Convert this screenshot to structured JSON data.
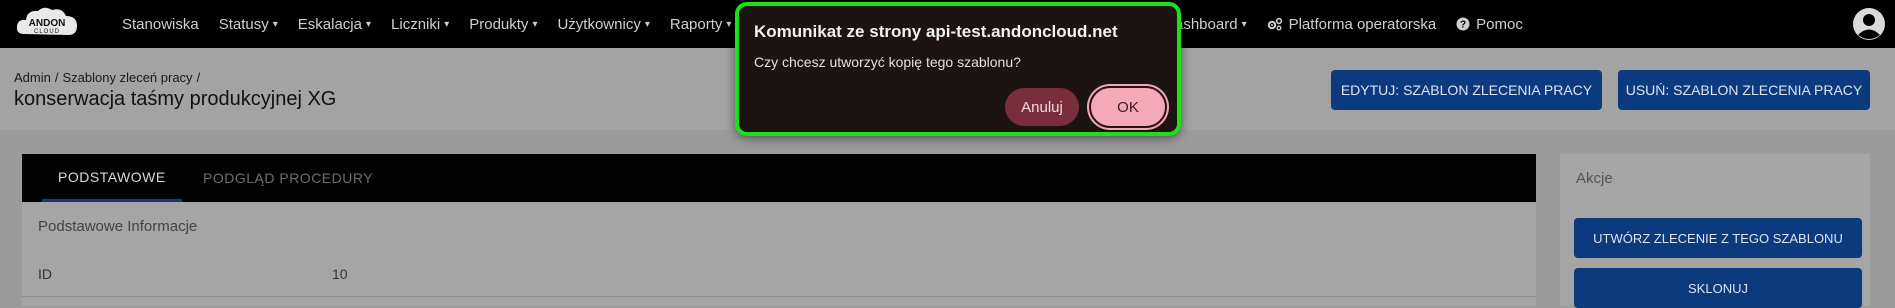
{
  "navbar": {
    "logo_text_top": "ANDON",
    "logo_text_bottom": "CLOUD",
    "items": [
      {
        "label": "Stanowiska",
        "caret": ""
      },
      {
        "label": "Statusy",
        "caret": "▾"
      },
      {
        "label": "Eskalacja",
        "caret": "▾"
      },
      {
        "label": "Liczniki",
        "caret": "▾"
      },
      {
        "label": "Produkty",
        "caret": "▾"
      },
      {
        "label": "Użytkownicy",
        "caret": "▾"
      },
      {
        "label": "Raporty",
        "caret": "▾"
      }
    ],
    "right_items": [
      {
        "label": "ashboard",
        "caret": "▾",
        "icon": ""
      },
      {
        "label": "Platforma operatorska",
        "caret": "",
        "icon": "gears-icon"
      },
      {
        "label": "Pomoc",
        "caret": "",
        "icon": "question-circle-icon"
      }
    ],
    "avatar_icon": "user-circle-icon"
  },
  "header": {
    "breadcrumb": [
      "Admin",
      "/",
      "Szablony zleceń pracy",
      "/"
    ],
    "title": "konserwacja taśmy produkcyjnej XG",
    "edit_button": "EDYTUJ: SZABLON ZLECENIA PRACY",
    "delete_button": "USUŃ: SZABLON ZLECENIA PRACY"
  },
  "tabs": [
    {
      "label": "PODSTAWOWE",
      "active": true
    },
    {
      "label": "PODGLĄD PROCEDURY",
      "active": false
    }
  ],
  "basic_info": {
    "section_title": "Podstawowe Informacje",
    "rows": [
      {
        "label": "ID",
        "value": "10"
      }
    ]
  },
  "actions": {
    "title": "Akcje",
    "buttons": [
      "UTWÓRZ ZLECENIE Z TEGO SZABLONU",
      "SKLONUJ"
    ]
  },
  "dialog": {
    "title": "Komunikat ze strony api-test.andoncloud.net",
    "message": "Czy chcesz utworzyć kopię tego szablonu?",
    "cancel": "Anuluj",
    "ok": "OK"
  },
  "colors": {
    "navbar_bg": "#010101",
    "primary_button": "#0b3a7e",
    "dialog_bg": "#1c1313",
    "dialog_border": "#1ee019",
    "ok_button": "#f5a9b8",
    "cancel_button": "#7a2d3d"
  }
}
